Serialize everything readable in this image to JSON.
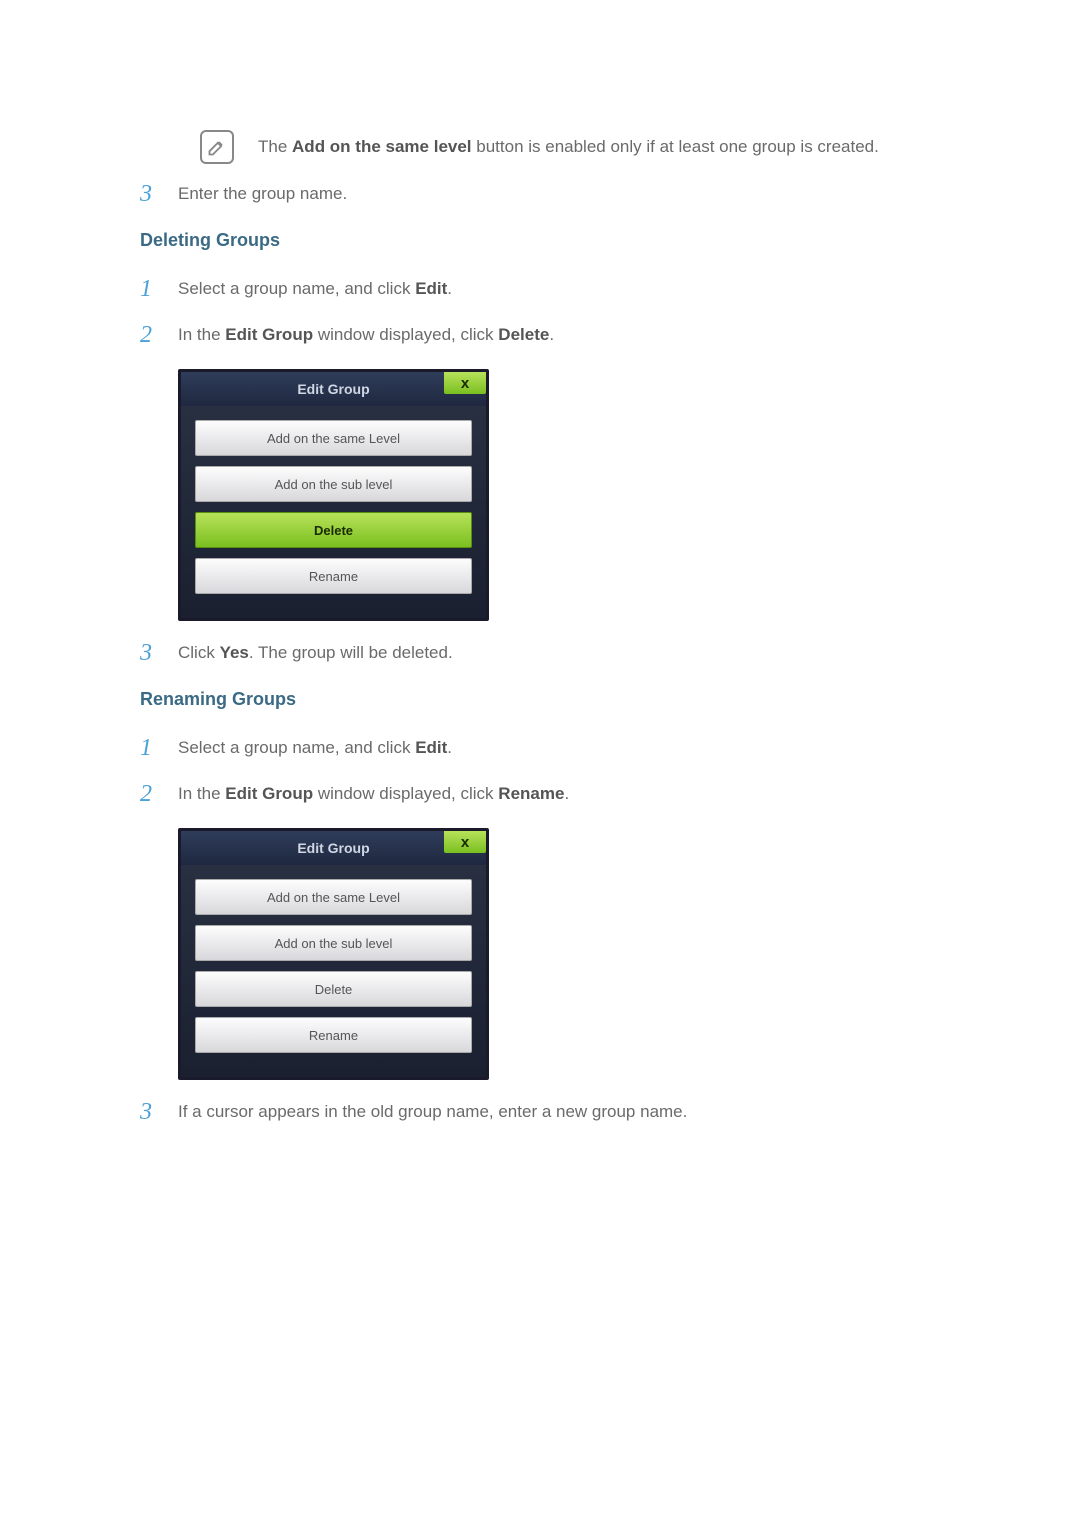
{
  "note": {
    "prefix": "The ",
    "bold": "Add on the same level",
    "suffix": " button is enabled only if at least one group is created."
  },
  "step_note_after": {
    "num": "3",
    "text": "Enter the group name."
  },
  "sections": {
    "delete": {
      "heading": "Deleting Groups",
      "steps": {
        "s1": {
          "num": "1",
          "prefix": "Select a group name, and click ",
          "bold": "Edit",
          "suffix": "."
        },
        "s2": {
          "num": "2",
          "prefix": "In the ",
          "bold1": "Edit Group",
          "mid": " window displayed, click ",
          "bold2": "Delete",
          "suffix": "."
        },
        "s3": {
          "num": "3",
          "prefix": "Click ",
          "bold": "Yes",
          "suffix": ". The group will be deleted."
        }
      },
      "dialog": {
        "title": "Edit Group",
        "close": "x",
        "btn1": "Add on the same Level",
        "btn2": "Add on the sub level",
        "btn3": "Delete",
        "btn4": "Rename"
      }
    },
    "rename": {
      "heading": "Renaming Groups",
      "steps": {
        "s1": {
          "num": "1",
          "prefix": "Select a group name, and click ",
          "bold": "Edit",
          "suffix": "."
        },
        "s2": {
          "num": "2",
          "prefix": "In the ",
          "bold1": "Edit Group",
          "mid": " window displayed, click ",
          "bold2": "Rename",
          "suffix": "."
        },
        "s3": {
          "num": "3",
          "text": "If a cursor appears in the old group name, enter a new group name."
        }
      },
      "dialog": {
        "title": "Edit Group",
        "close": "x",
        "btn1": "Add on the same Level",
        "btn2": "Add on the sub level",
        "btn3": "Delete",
        "btn4": "Rename"
      }
    }
  }
}
